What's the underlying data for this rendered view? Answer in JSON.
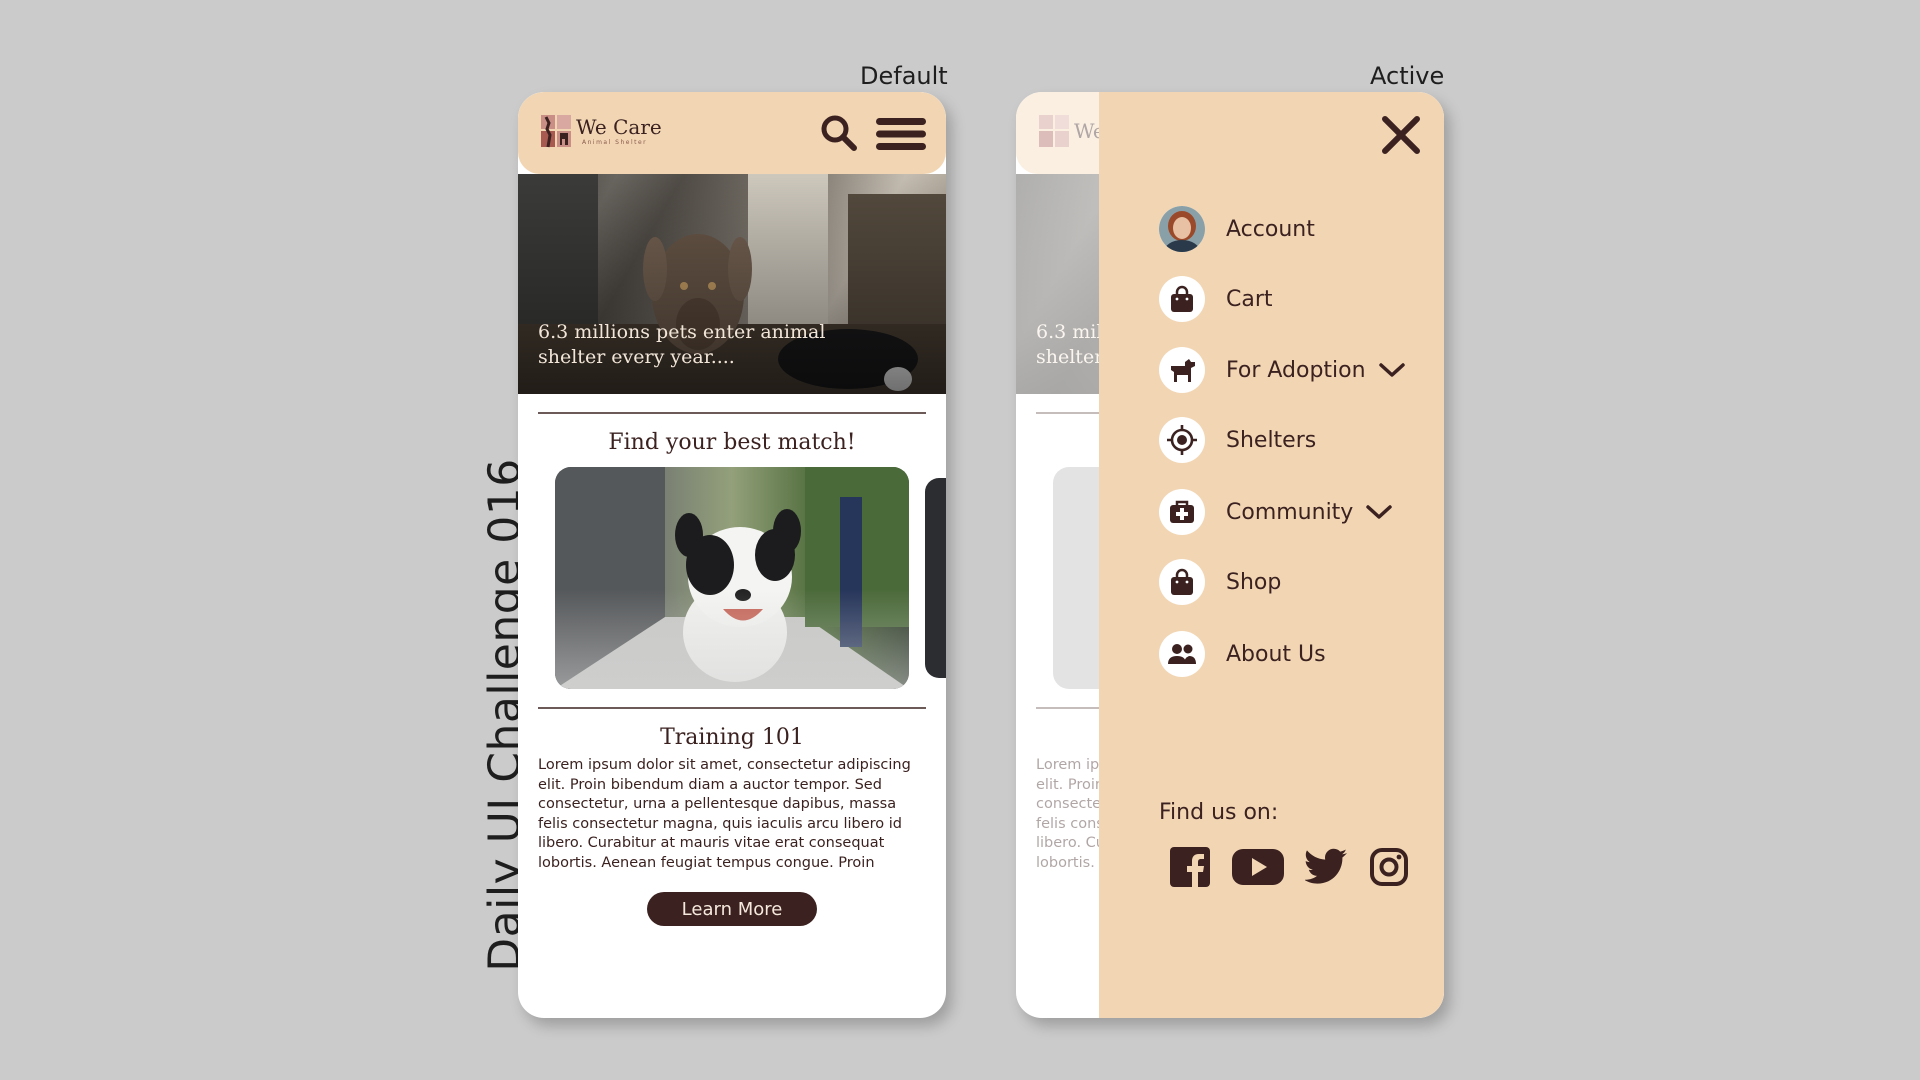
{
  "page": {
    "side_title": "Daily UI Challenge 016",
    "labels": {
      "default": "Default",
      "active": "Active"
    }
  },
  "brand": {
    "name": "We Care",
    "tagline": "Animal Shelter"
  },
  "hero": {
    "text": "6.3 millions pets enter animal shelter every year...."
  },
  "match": {
    "title": "Find your best match!"
  },
  "article": {
    "title": "Training 101",
    "body": "Lorem ipsum dolor sit amet, consectetur adipiscing elit. Proin bibendum diam a auctor tempor. Sed consectetur, urna a pellentesque dapibus, massa felis consectetur magna, quis iaculis arcu libero id libero. Curabitur at mauris vitae erat consequat lobortis. Aenean feugiat tempus congue. Proin",
    "cta": "Learn More"
  },
  "menu": {
    "items": [
      {
        "label": "Account",
        "icon": "avatar",
        "has_chevron": false
      },
      {
        "label": "Cart",
        "icon": "shopping-bag-icon",
        "has_chevron": false
      },
      {
        "label": "For Adoption",
        "icon": "dog-icon",
        "has_chevron": true
      },
      {
        "label": "Shelters",
        "icon": "location-target-icon",
        "has_chevron": false
      },
      {
        "label": "Community",
        "icon": "medical-kit-icon",
        "has_chevron": true
      },
      {
        "label": "Shop",
        "icon": "shopping-bag-icon",
        "has_chevron": false
      },
      {
        "label": "About Us",
        "icon": "people-icon",
        "has_chevron": false
      }
    ],
    "find_us": "Find us on:",
    "socials": [
      "facebook-icon",
      "youtube-icon",
      "twitter-icon",
      "instagram-icon"
    ]
  },
  "colors": {
    "background": "#cbcbcb",
    "header": "#f2d6b4",
    "primary_dark": "#3b2220",
    "button_text": "#f5e8dc",
    "white": "#ffffff"
  }
}
